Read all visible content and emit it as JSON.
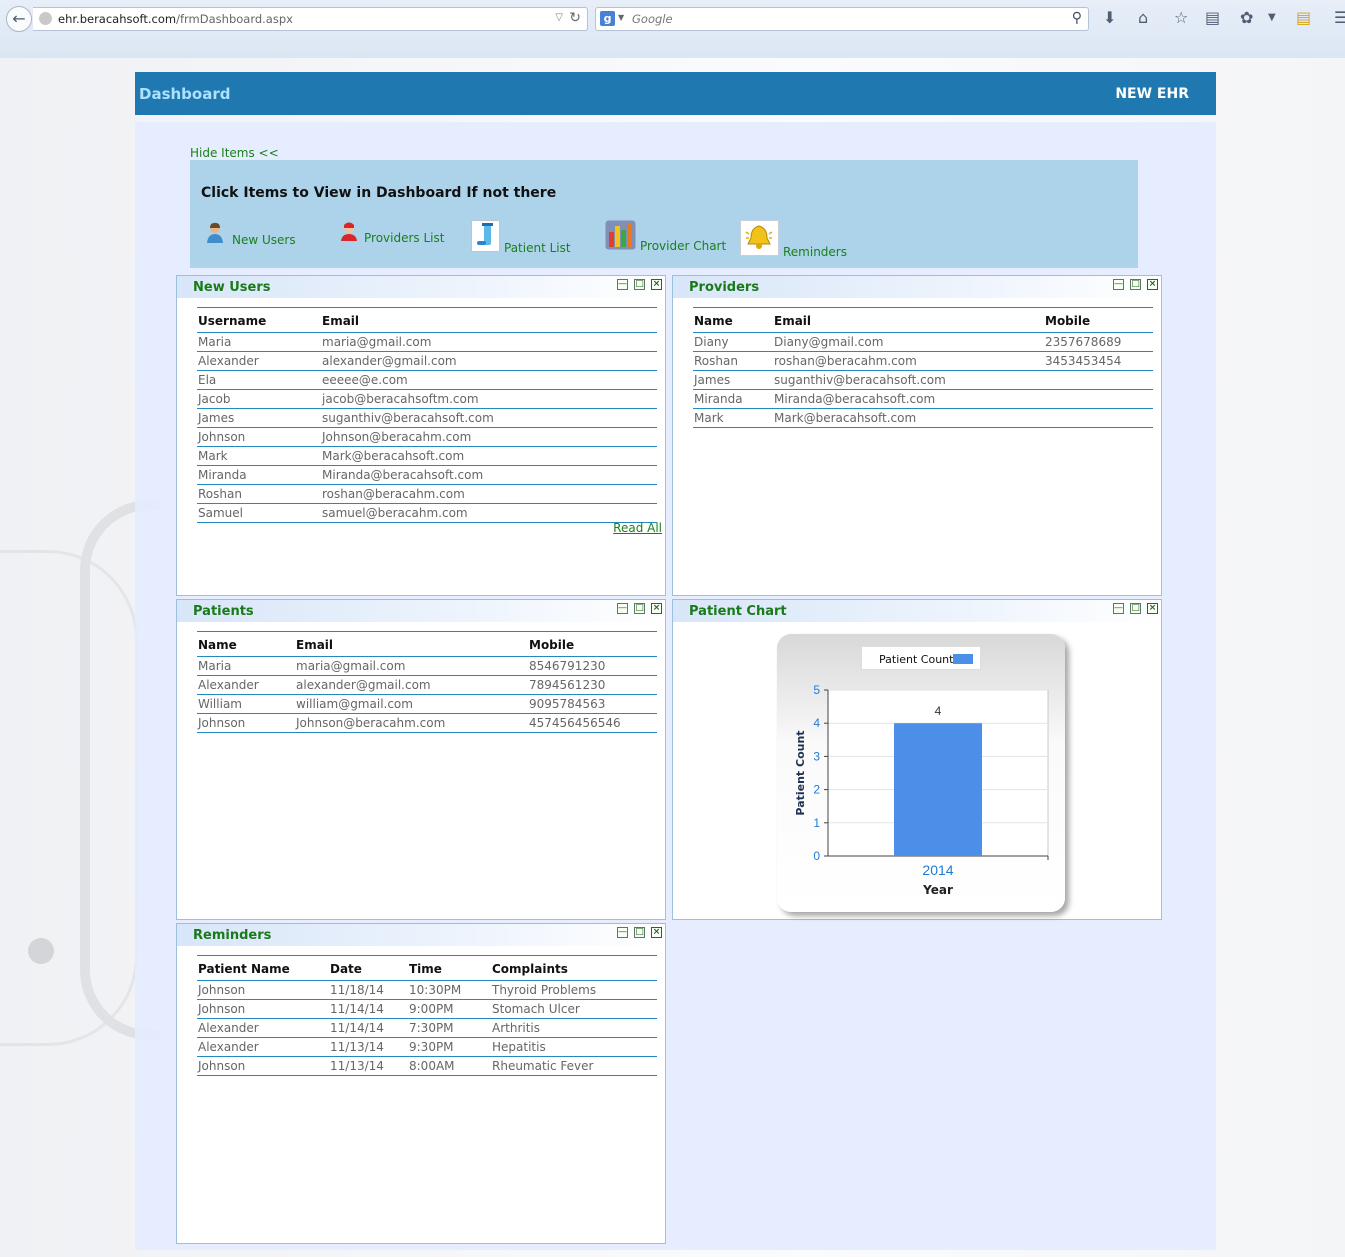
{
  "browser": {
    "url_host": "ehr.beracahsoft.com",
    "url_path": "/frmDashboard.aspx",
    "search_engine_icon": "g",
    "search_placeholder": "Google"
  },
  "header": {
    "title": "Dashboard",
    "brand": "NEW EHR"
  },
  "hide_items_label": "Hide Items <<",
  "items_panel": {
    "heading": "Click Items to View in Dashboard If not there",
    "items": [
      {
        "label": "New Users",
        "icon": "user-icon"
      },
      {
        "label": "Providers List",
        "icon": "provider-icon"
      },
      {
        "label": "Patient List",
        "icon": "patient-list-icon"
      },
      {
        "label": "Provider Chart",
        "icon": "bar-chart-icon"
      },
      {
        "label": "Reminders",
        "icon": "bell-icon"
      }
    ]
  },
  "new_users": {
    "title": "New Users",
    "columns": [
      "Username",
      "Email"
    ],
    "rows": [
      [
        "Maria",
        "maria@gmail.com"
      ],
      [
        "Alexander",
        "alexander@gmail.com"
      ],
      [
        "Ela",
        "eeeee@e.com"
      ],
      [
        "Jacob",
        "jacob@beracahsoftm.com"
      ],
      [
        "James",
        "suganthiv@beracahsoft.com"
      ],
      [
        "Johnson",
        "Johnson@beracahm.com"
      ],
      [
        "Mark",
        "Mark@beracahsoft.com"
      ],
      [
        "Miranda",
        "Miranda@beracahsoft.com"
      ],
      [
        "Roshan",
        "roshan@beracahm.com"
      ],
      [
        "Samuel",
        "samuel@beracahm.com"
      ]
    ],
    "read_all": "Read All"
  },
  "providers": {
    "title": "Providers",
    "columns": [
      "Name",
      "Email",
      "Mobile"
    ],
    "rows": [
      [
        "Diany",
        "Diany@gmail.com",
        "2357678689"
      ],
      [
        "Roshan",
        "roshan@beracahm.com",
        "3453453454"
      ],
      [
        "James",
        "suganthiv@beracahsoft.com",
        ""
      ],
      [
        "Miranda",
        "Miranda@beracahsoft.com",
        ""
      ],
      [
        "Mark",
        "Mark@beracahsoft.com",
        ""
      ]
    ]
  },
  "patients": {
    "title": "Patients",
    "columns": [
      "Name",
      "Email",
      "Mobile"
    ],
    "rows": [
      [
        "Maria",
        "maria@gmail.com",
        "8546791230"
      ],
      [
        "Alexander",
        "alexander@gmail.com",
        "7894561230"
      ],
      [
        "William",
        "william@gmail.com",
        "9095784563"
      ],
      [
        "Johnson",
        "Johnson@beracahm.com",
        "457456456546"
      ]
    ]
  },
  "patient_chart": {
    "title": "Patient Chart"
  },
  "reminders": {
    "title": "Reminders",
    "columns": [
      "Patient Name",
      "Date",
      "Time",
      "Complaints"
    ],
    "rows": [
      [
        "Johnson",
        "11/18/14",
        "10:30PM",
        "Thyroid Problems"
      ],
      [
        "Johnson",
        "11/14/14",
        "9:00PM",
        "Stomach Ulcer"
      ],
      [
        "Alexander",
        "11/14/14",
        "7:30PM",
        "Arthritis"
      ],
      [
        "Alexander",
        "11/13/14",
        "9:30PM",
        "Hepatitis"
      ],
      [
        "Johnson",
        "11/13/14",
        "8:00AM",
        "Rheumatic Fever"
      ]
    ]
  },
  "chart_data": {
    "type": "bar",
    "categories": [
      "2014"
    ],
    "series": [
      {
        "name": "Patient Count",
        "values": [
          4
        ],
        "color": "#4b8fe8"
      }
    ],
    "data_labels": [
      "4"
    ],
    "title": "",
    "xlabel": "Year",
    "ylabel": "Patient Count",
    "ylim": [
      0,
      5
    ],
    "yticks": [
      0,
      1,
      2,
      3,
      4,
      5
    ],
    "legend": "top-center",
    "grid": true
  },
  "colors": {
    "header": "#1f78b0",
    "accent_green": "#1b7f1b",
    "bar": "#4b8fe8"
  }
}
